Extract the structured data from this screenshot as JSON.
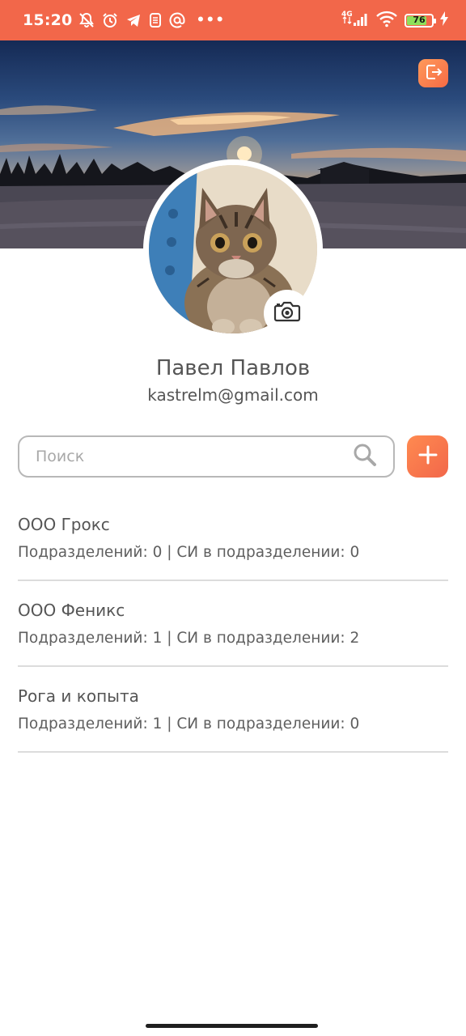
{
  "status_bar": {
    "time": "15:20",
    "network": "4G",
    "battery": "76",
    "icons": [
      "bell-off-icon",
      "alarm-icon",
      "telegram-icon",
      "app-icon",
      "at-icon",
      "more-dots-icon",
      "signal-icon",
      "wifi-icon",
      "battery-icon",
      "charging-icon"
    ]
  },
  "header": {
    "logout_icon": "logout-icon"
  },
  "profile": {
    "name": "Павел Павлов",
    "email": "kastrelm@gmail.com",
    "camera_icon": "camera-icon"
  },
  "search": {
    "placeholder": "Поиск",
    "value": ""
  },
  "actions": {
    "add_icon": "plus-icon"
  },
  "organizations": [
    {
      "name": "ООО Грокс",
      "meta": "Подразделений: 0 | СИ в подразделении: 0"
    },
    {
      "name": "ООО Феникс",
      "meta": "Подразделений: 1 | СИ в подразделении: 2"
    },
    {
      "name": "Рога и копыта",
      "meta": "Подразделений: 1 | СИ в подразделении: 0"
    }
  ],
  "colors": {
    "accent": "#f2674a",
    "accent_light": "#ff9a5a",
    "battery_fill": "#8ee05a"
  }
}
